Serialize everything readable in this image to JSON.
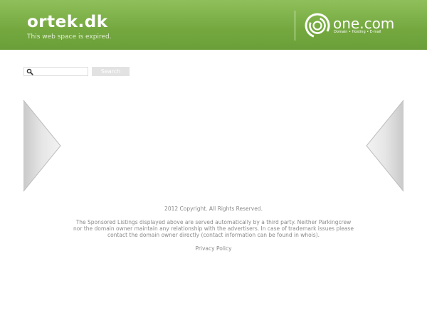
{
  "header": {
    "domain": "ortek.dk",
    "subtitle": "This web space is expired.",
    "brand_name": "one.com",
    "brand_tagline": "Domain • Hosting • E-mail"
  },
  "search": {
    "placeholder": "",
    "value": "",
    "button_label": "Search"
  },
  "footer": {
    "copyright": "2012 Copyright. All Rights Reserved.",
    "disclaimer": "The Sponsored Listings displayed above are served automatically by a third party. Neither Parkingcrew nor the domain owner maintain any relationship with the advertisers. In case of trademark issues please contact the domain owner directly (contact information can be found in whois).",
    "privacy_label": "Privacy Policy"
  },
  "colors": {
    "header_green": "#74a83f",
    "footer_text": "#8a8a8a"
  },
  "icons": {
    "search": "search-icon",
    "left_arrow": "arrow-left-icon",
    "right_arrow": "arrow-right-icon",
    "brand_logo": "one-com-logo-icon"
  }
}
